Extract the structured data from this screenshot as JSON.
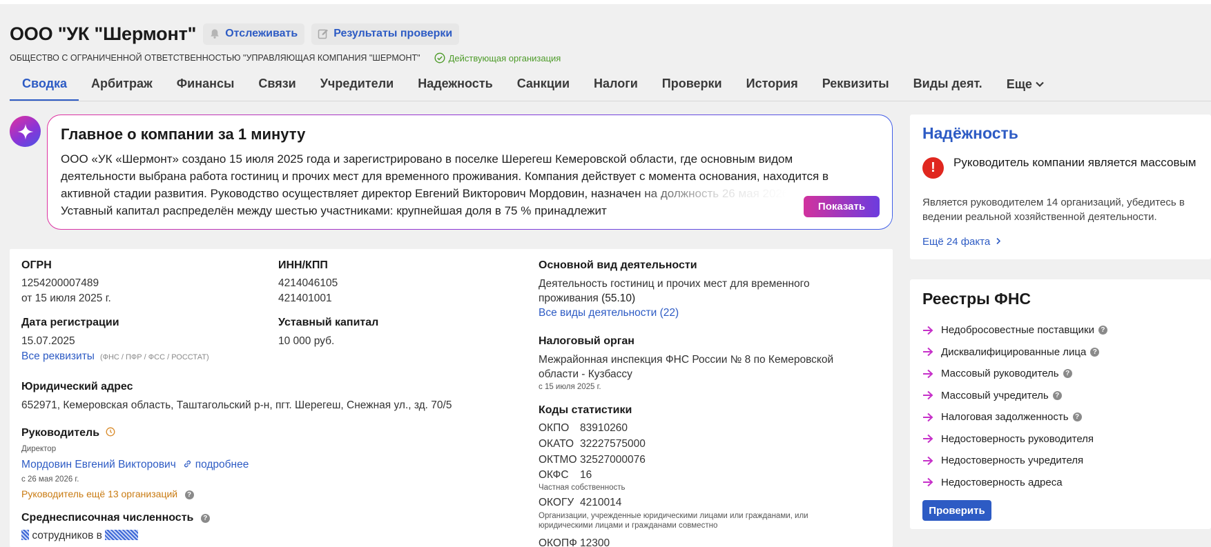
{
  "header": {
    "company_name": "ООО \"УК \"Шермонт\"",
    "track_label": "Отслеживать",
    "check_results_label": "Результаты проверки",
    "full_name": "ОБЩЕСТВО С ОГРАНИЧЕННОЙ ОТВЕТСТВЕННОСТЬЮ \"УПРАВЛЯЮЩАЯ КОМПАНИЯ \"ШЕРМОНТ\"",
    "status": "Действующая организация"
  },
  "tabs": [
    {
      "label": "Сводка",
      "active": true
    },
    {
      "label": "Арбитраж"
    },
    {
      "label": "Финансы"
    },
    {
      "label": "Связи"
    },
    {
      "label": "Учредители"
    },
    {
      "label": "Надежность"
    },
    {
      "label": "Санкции"
    },
    {
      "label": "Налоги"
    },
    {
      "label": "Проверки"
    },
    {
      "label": "История"
    },
    {
      "label": "Реквизиты"
    },
    {
      "label": "Виды деят."
    },
    {
      "label": "Еще"
    }
  ],
  "summary": {
    "title": "Главное о компании за 1 минуту",
    "text": "ООО «УК «Шермонт» создано 15 июля 2025 года и зарегистрировано в поселке Шерегеш Кемеровской области, где основным видом деятельности выбрана работа гостиниц и прочих мест для временного проживания. Компания действует с момента основания, находится в активной стадии развития. Руководство осуществляет директор Евгений Викторович Мордовин, назначен на должность 26 мая 2026 года. Уставный капитал распределён между шестью участниками: крупнейшая доля в 75 % принадлежит",
    "show_button": "Показать"
  },
  "details": {
    "ogrn_label": "ОГРН",
    "ogrn_value": "1254200007489",
    "ogrn_date": "от 15 июля 2025 г.",
    "inn_label": "ИНН/КПП",
    "inn_value": "4214046105",
    "kpp_value": "421401001",
    "reg_date_label": "Дата регистрации",
    "reg_date_value": "15.07.2025",
    "capital_label": "Уставный капитал",
    "capital_value": "10 000 руб.",
    "all_requisites_link": "Все реквизиты",
    "requisites_tag": "(ФНС / ПФР / ФСС / РОССТАТ)",
    "address_label": "Юридический адрес",
    "address_value": "652971, Кемеровская область, Таштагольский р-н, пгт. Шерегеш, Снежная ул., зд. 70/5",
    "head_label": "Руководитель",
    "head_position": "Директор",
    "head_name": "Мордовин Евгений Викторович",
    "head_more_link": "подробнее",
    "head_since": "с 26 мая 2026 г.",
    "head_other_orgs": "Руководитель ещё 13 организаций",
    "headcount_label": "Среднесписочная численность",
    "headcount_employees": "сотрудников в",
    "activity_label": "Основной вид деятельности",
    "activity_value": "Деятельность гостиниц и прочих мест для временного проживания",
    "activity_code": "(55.10)",
    "activity_all_link": "Все виды деятельности (22)",
    "tax_label": "Налоговый орган",
    "tax_value": "Межрайонная инспекция ФНС России № 8 по Кемеровской области - Кузбассу",
    "tax_since": "с 15 июля 2025 г.",
    "stats_label": "Коды статистики",
    "codes": {
      "okpo_k": "ОКПО",
      "okpo_v": "83910260",
      "okato_k": "ОКАТО",
      "okato_v": "32227575000",
      "oktmo_k": "ОКТМО",
      "oktmo_v": "32527000076",
      "okfs_k": "ОКФС",
      "okfs_v": "16",
      "okfs_note": "Частная собственность",
      "okogu_k": "ОКОГУ",
      "okogu_v": "4210014",
      "okogu_note": "Организации, учрежденные юридическими лицами или гражданами, или юридическими лицами и гражданами совместно",
      "okopf_k": "ОКОПФ",
      "okopf_v": "12300"
    }
  },
  "reliability": {
    "title": "Надёжность",
    "alert": "Руководитель компании является массовым",
    "desc": "Является руководителем 14 организаций, убедитесь в ведении реальной хозяйственной деятельности.",
    "more_link": "Ещё 24 факта"
  },
  "registries": {
    "title": "Реестры ФНС",
    "items": [
      {
        "label": "Недобросовестные поставщики",
        "help": true
      },
      {
        "label": "Дисквалифицированные лица",
        "help": true
      },
      {
        "label": "Массовый руководитель",
        "help": true
      },
      {
        "label": "Массовый учредитель",
        "help": true
      },
      {
        "label": "Налоговая задолженность",
        "help": true
      },
      {
        "label": "Недостоверность руководителя",
        "help": false
      },
      {
        "label": "Недостоверность учредителя",
        "help": false
      },
      {
        "label": "Недостоверность адреса",
        "help": false
      }
    ],
    "check_button": "Проверить"
  },
  "colors": {
    "accent": "#2d5bc4",
    "status_green": "#4d9b29",
    "alert_red": "#e0271f",
    "warning_orange": "#c97b12",
    "arrow_magenta": "#c630c9"
  }
}
